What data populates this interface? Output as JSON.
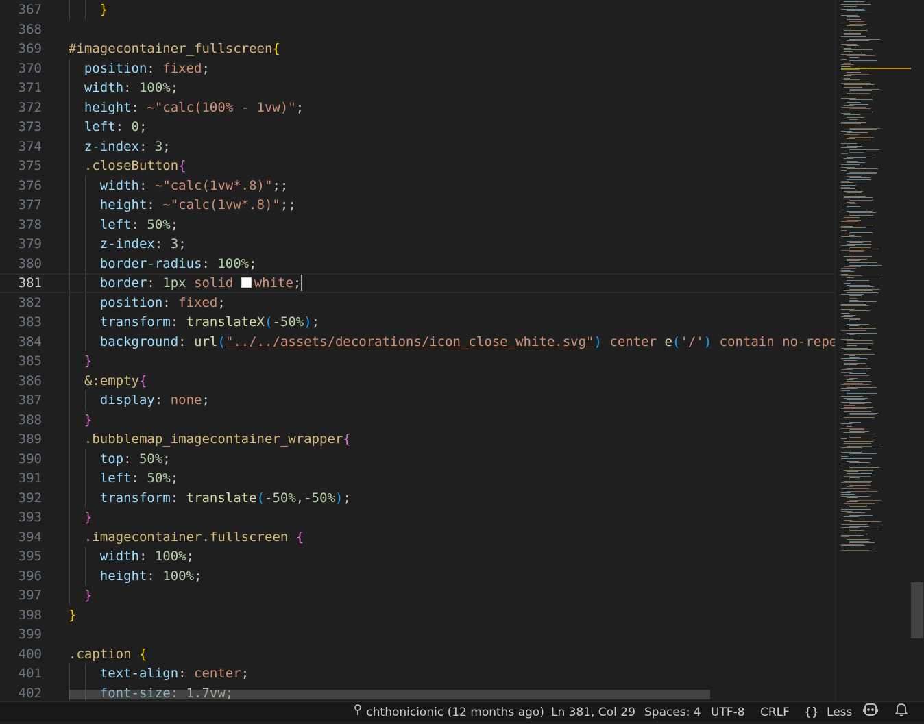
{
  "editor": {
    "current_line": 381,
    "lines": [
      {
        "n": "367",
        "tokens": [
          [
            "    ",
            ""
          ],
          [
            "}",
            "b1"
          ]
        ]
      },
      {
        "n": "368",
        "tokens": []
      },
      {
        "n": "369",
        "tokens": [
          [
            "#imagecontainer_fullscreen",
            "selector"
          ],
          [
            "{",
            "b1"
          ]
        ]
      },
      {
        "n": "370",
        "tokens": [
          [
            "  position",
            "prop"
          ],
          [
            ": ",
            "punc"
          ],
          [
            "fixed",
            "val"
          ],
          [
            ";",
            "punc"
          ]
        ]
      },
      {
        "n": "371",
        "tokens": [
          [
            "  width",
            "prop"
          ],
          [
            ": ",
            "punc"
          ],
          [
            "100%",
            "num"
          ],
          [
            ";",
            "punc"
          ]
        ]
      },
      {
        "n": "372",
        "tokens": [
          [
            "  height",
            "prop"
          ],
          [
            ": ",
            "punc"
          ],
          [
            "~\"calc(100% - 1vw)\"",
            "str"
          ],
          [
            ";",
            "punc"
          ]
        ]
      },
      {
        "n": "373",
        "tokens": [
          [
            "  left",
            "prop"
          ],
          [
            ": ",
            "punc"
          ],
          [
            "0",
            "num"
          ],
          [
            ";",
            "punc"
          ]
        ]
      },
      {
        "n": "374",
        "tokens": [
          [
            "  z-index",
            "prop"
          ],
          [
            ": ",
            "punc"
          ],
          [
            "3",
            "num"
          ],
          [
            ";",
            "punc"
          ]
        ]
      },
      {
        "n": "375",
        "tokens": [
          [
            "  .closeButton",
            "selector"
          ],
          [
            "{",
            "b2"
          ]
        ]
      },
      {
        "n": "376",
        "tokens": [
          [
            "    width",
            "prop"
          ],
          [
            ": ",
            "punc"
          ],
          [
            "~\"calc(1vw*.8)\"",
            "str"
          ],
          [
            ";;",
            "punc"
          ]
        ]
      },
      {
        "n": "377",
        "tokens": [
          [
            "    height",
            "prop"
          ],
          [
            ": ",
            "punc"
          ],
          [
            "~\"calc(1vw*.8)\"",
            "str"
          ],
          [
            ";;",
            "punc"
          ]
        ]
      },
      {
        "n": "378",
        "tokens": [
          [
            "    left",
            "prop"
          ],
          [
            ": ",
            "punc"
          ],
          [
            "50%",
            "num"
          ],
          [
            ";",
            "punc"
          ]
        ]
      },
      {
        "n": "379",
        "tokens": [
          [
            "    z-index",
            "prop"
          ],
          [
            ": ",
            "punc"
          ],
          [
            "3",
            "num"
          ],
          [
            ";",
            "punc"
          ]
        ]
      },
      {
        "n": "380",
        "tokens": [
          [
            "    border-radius",
            "prop"
          ],
          [
            ": ",
            "punc"
          ],
          [
            "100%",
            "num"
          ],
          [
            ";",
            "punc"
          ]
        ]
      },
      {
        "n": "381",
        "tokens": [
          [
            "    border",
            "prop"
          ],
          [
            ": ",
            "punc"
          ],
          [
            "1px",
            "num"
          ],
          [
            " ",
            "punc"
          ],
          [
            "solid",
            "val"
          ],
          [
            " ",
            "punc"
          ],
          [
            "SWATCH",
            "swatch"
          ],
          [
            "white",
            "val"
          ],
          [
            ";",
            "punc"
          ],
          [
            "CURSOR",
            "cursor"
          ]
        ]
      },
      {
        "n": "382",
        "tokens": [
          [
            "    position",
            "prop"
          ],
          [
            ": ",
            "punc"
          ],
          [
            "fixed",
            "val"
          ],
          [
            ";",
            "punc"
          ]
        ]
      },
      {
        "n": "383",
        "tokens": [
          [
            "    transform",
            "prop"
          ],
          [
            ": ",
            "punc"
          ],
          [
            "translateX",
            "fn"
          ],
          [
            "(",
            "b3"
          ],
          [
            "-50%",
            "num"
          ],
          [
            ")",
            "b3"
          ],
          [
            ";",
            "punc"
          ]
        ]
      },
      {
        "n": "384",
        "tokens": [
          [
            "    background",
            "prop"
          ],
          [
            ": ",
            "punc"
          ],
          [
            "url",
            "fn"
          ],
          [
            "(",
            "b3"
          ],
          [
            "\"../../assets/decorations/icon_close_white.svg\"",
            "url"
          ],
          [
            ")",
            "b3"
          ],
          [
            " ",
            "punc"
          ],
          [
            "center",
            "val"
          ],
          [
            " ",
            "punc"
          ],
          [
            "e",
            "fn"
          ],
          [
            "(",
            "b3"
          ],
          [
            "'/'",
            "str"
          ],
          [
            ")",
            "b3"
          ],
          [
            " ",
            "punc"
          ],
          [
            "contain",
            "val"
          ],
          [
            " ",
            "punc"
          ],
          [
            "no-repeat",
            "val"
          ],
          [
            ";",
            "punc"
          ]
        ]
      },
      {
        "n": "385",
        "tokens": [
          [
            "  ",
            ""
          ],
          [
            "}",
            "b2"
          ]
        ]
      },
      {
        "n": "386",
        "tokens": [
          [
            "  &:empty",
            "selector"
          ],
          [
            "{",
            "b2"
          ]
        ]
      },
      {
        "n": "387",
        "tokens": [
          [
            "    display",
            "prop"
          ],
          [
            ": ",
            "punc"
          ],
          [
            "none",
            "val"
          ],
          [
            ";",
            "punc"
          ]
        ]
      },
      {
        "n": "388",
        "tokens": [
          [
            "  ",
            ""
          ],
          [
            "}",
            "b2"
          ]
        ]
      },
      {
        "n": "389",
        "tokens": [
          [
            "  .bubblemap_imagecontainer_wrapper",
            "selector"
          ],
          [
            "{",
            "b2"
          ]
        ]
      },
      {
        "n": "390",
        "tokens": [
          [
            "    top",
            "prop"
          ],
          [
            ": ",
            "punc"
          ],
          [
            "50%",
            "num"
          ],
          [
            ";",
            "punc"
          ]
        ]
      },
      {
        "n": "391",
        "tokens": [
          [
            "    left",
            "prop"
          ],
          [
            ": ",
            "punc"
          ],
          [
            "50%",
            "num"
          ],
          [
            ";",
            "punc"
          ]
        ]
      },
      {
        "n": "392",
        "tokens": [
          [
            "    transform",
            "prop"
          ],
          [
            ": ",
            "punc"
          ],
          [
            "translate",
            "fn"
          ],
          [
            "(",
            "b3"
          ],
          [
            "-50%",
            "num"
          ],
          [
            ",",
            "punc"
          ],
          [
            "-50%",
            "num"
          ],
          [
            ")",
            "b3"
          ],
          [
            ";",
            "punc"
          ]
        ]
      },
      {
        "n": "393",
        "tokens": [
          [
            "  ",
            ""
          ],
          [
            "}",
            "b2"
          ]
        ]
      },
      {
        "n": "394",
        "tokens": [
          [
            "  .imagecontainer.fullscreen",
            "selector"
          ],
          [
            " ",
            "punc"
          ],
          [
            "{",
            "b2"
          ]
        ]
      },
      {
        "n": "395",
        "tokens": [
          [
            "    width",
            "prop"
          ],
          [
            ": ",
            "punc"
          ],
          [
            "100%",
            "num"
          ],
          [
            ";",
            "punc"
          ]
        ]
      },
      {
        "n": "396",
        "tokens": [
          [
            "    height",
            "prop"
          ],
          [
            ": ",
            "punc"
          ],
          [
            "100%",
            "num"
          ],
          [
            ";",
            "punc"
          ]
        ]
      },
      {
        "n": "397",
        "tokens": [
          [
            "  ",
            ""
          ],
          [
            "}",
            "b2"
          ]
        ]
      },
      {
        "n": "398",
        "tokens": [
          [
            "}",
            "b1"
          ]
        ]
      },
      {
        "n": "399",
        "tokens": []
      },
      {
        "n": "400",
        "tokens": [
          [
            ".caption",
            "selector"
          ],
          [
            " ",
            "punc"
          ],
          [
            "{",
            "b1"
          ]
        ]
      },
      {
        "n": "401",
        "tokens": [
          [
            "    text-align",
            "prop"
          ],
          [
            ": ",
            "punc"
          ],
          [
            "center",
            "val"
          ],
          [
            ";",
            "punc"
          ]
        ]
      },
      {
        "n": "402",
        "tokens": [
          [
            "    font-size",
            "prop"
          ],
          [
            ": ",
            "punc"
          ],
          [
            "1.7vw",
            "num"
          ],
          [
            ";",
            "punc"
          ]
        ]
      }
    ]
  },
  "statusbar": {
    "git_blame": "chthonicionic (12 months ago)",
    "cursor_position": "Ln 381, Col 29",
    "indentation": "Spaces: 4",
    "encoding": "UTF-8",
    "line_ending": "CRLF",
    "language_icon": "{}",
    "language": "Less",
    "copilot_icon": "copilot-icon",
    "notifications_icon": "bell-icon"
  },
  "colors": {
    "background": "#1f1f1f",
    "selector": "#d7ba7d",
    "property": "#9cdcfe",
    "value": "#ce9178",
    "number": "#b5cea8",
    "bracket_level1": "#ffd700",
    "bracket_level2": "#da70d6",
    "bracket_level3": "#179fff"
  }
}
